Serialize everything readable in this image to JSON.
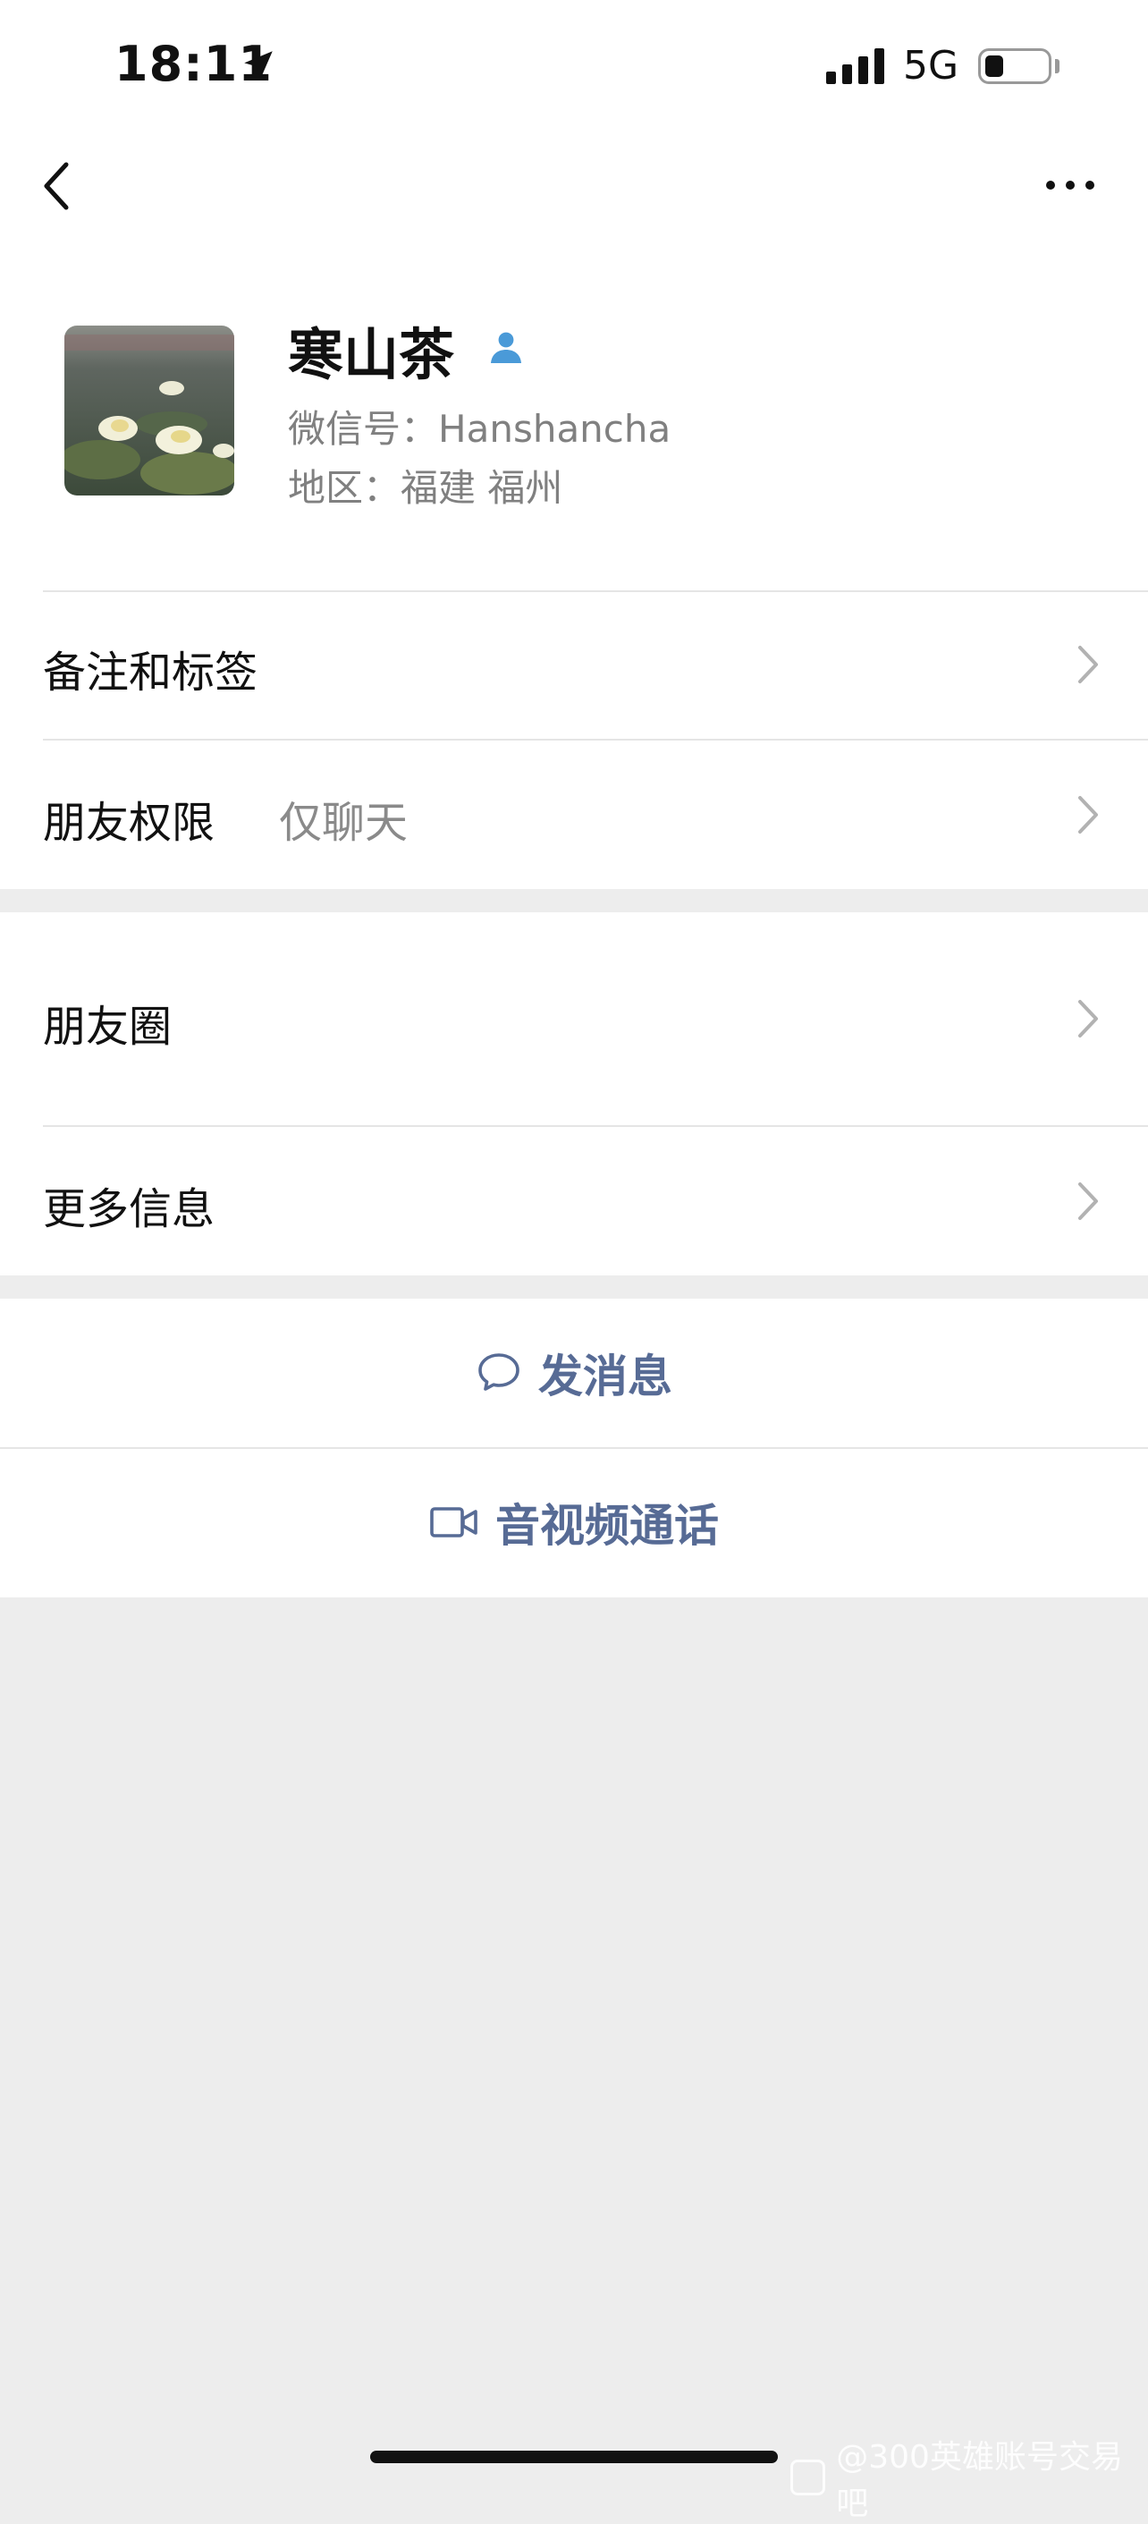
{
  "status_bar": {
    "time": "18:11",
    "network": "5G",
    "battery_level": 0.3
  },
  "nav": {
    "back_icon": "chevron-left-icon",
    "more_icon": "ellipsis-icon"
  },
  "profile": {
    "name": "寒山茶",
    "wechat_id": "微信号：Hanshancha",
    "region": "地区：福建 福州",
    "badge_icon": "person-icon"
  },
  "rows": {
    "remarks_label": "备注和标签",
    "permissions_label": "朋友权限",
    "permissions_value": "仅聊天",
    "moments_label": "朋友圈",
    "more_info_label": "更多信息"
  },
  "actions": {
    "message_label": "发消息",
    "call_label": "音视频通话"
  },
  "watermark": "@300英雄账号交易吧",
  "colors": {
    "link": "#576b95",
    "background": "#ededed",
    "badge": "#4a9ad8"
  }
}
